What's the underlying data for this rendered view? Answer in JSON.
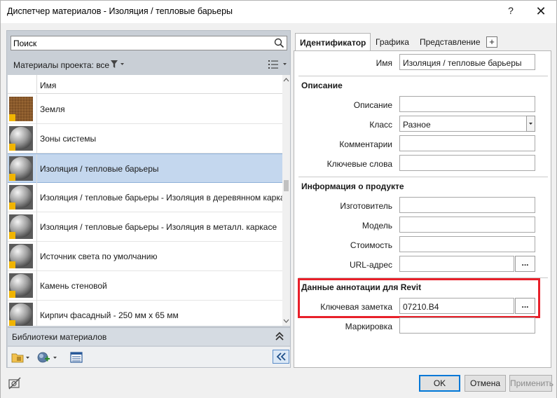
{
  "window": {
    "title": "Диспетчер материалов - Изоляция / тепловые барьеры",
    "help_label": "?",
    "close_label": "✕"
  },
  "left": {
    "search": {
      "value": "Поиск",
      "placeholder": "Поиск"
    },
    "project_materials_label": "Материалы проекта: все",
    "column_header": "Имя",
    "materials": [
      {
        "name": "Земля",
        "thumb": "earth",
        "selected": false
      },
      {
        "name": "Зоны системы",
        "thumb": "sphere",
        "selected": false
      },
      {
        "name": "Изоляция / тепловые барьеры",
        "thumb": "sphere",
        "selected": true
      },
      {
        "name": "Изоляция / тепловые барьеры - Изоляция в деревянном карка",
        "thumb": "sphere",
        "selected": false
      },
      {
        "name": "Изоляция / тепловые барьеры - Изоляция в металл. каркасе",
        "thumb": "sphere",
        "selected": false
      },
      {
        "name": "Источник света по умолчанию",
        "thumb": "sphere",
        "selected": false
      },
      {
        "name": "Камень стеновой",
        "thumb": "sphere",
        "selected": false
      },
      {
        "name": "Кирпич фасадный - 250 мм х 65 мм",
        "thumb": "sphere",
        "selected": false
      }
    ],
    "libraries_label": "Библиотеки материалов"
  },
  "right": {
    "tabs": [
      {
        "label": "Идентификатор",
        "active": true
      },
      {
        "label": "Графика",
        "active": false
      },
      {
        "label": "Представление",
        "active": false
      }
    ],
    "add_tab_label": "+",
    "name_label": "Имя",
    "name_value": "Изоляция / тепловые барьеры",
    "sections": {
      "description": {
        "title": "Описание",
        "description_label": "Описание",
        "description_value": "",
        "class_label": "Класс",
        "class_value": "Разное",
        "comments_label": "Комментарии",
        "comments_value": "",
        "keywords_label": "Ключевые слова",
        "keywords_value": ""
      },
      "product": {
        "title": "Информация о продукте",
        "manufacturer_label": "Изготовитель",
        "manufacturer_value": "",
        "model_label": "Модель",
        "model_value": "",
        "cost_label": "Стоимость",
        "cost_value": "",
        "url_label": "URL-адрес",
        "url_value": "",
        "url_button": "..."
      },
      "revit": {
        "title": "Данные аннотации для Revit",
        "keynote_label": "Ключевая заметка",
        "keynote_value": "07210.B4",
        "keynote_button": "...",
        "mark_label": "Маркировка",
        "mark_value": ""
      }
    }
  },
  "footer": {
    "ok_label": "OK",
    "cancel_label": "Отмена",
    "apply_label": "Применить"
  },
  "colors": {
    "selection": "#c4d7ee",
    "highlight": "#e8202a",
    "ok_border": "#0078d7",
    "thumb_badge": "#f0b400"
  }
}
